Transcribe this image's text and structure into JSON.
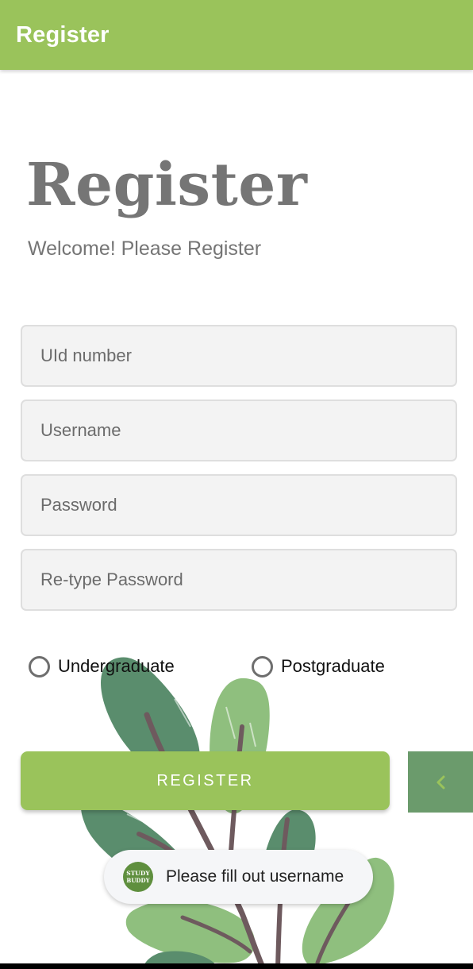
{
  "app_bar": {
    "title": "Register"
  },
  "main": {
    "heading": "Register",
    "subtitle": "Welcome! Please Register"
  },
  "form": {
    "uid": {
      "placeholder": "UId number",
      "value": ""
    },
    "username": {
      "placeholder": "Username",
      "value": ""
    },
    "password": {
      "placeholder": "Password",
      "value": ""
    },
    "retype_password": {
      "placeholder": "Re-type Password",
      "value": ""
    },
    "level_options": [
      {
        "label": "Undergraduate",
        "selected": false
      },
      {
        "label": "Postgraduate",
        "selected": false
      }
    ],
    "register_label": "REGISTER"
  },
  "back_tab": {
    "icon": "chevron-left-icon"
  },
  "toast": {
    "logo_text": [
      "STUDY",
      "BUDDY"
    ],
    "message": "Please fill out username"
  },
  "colors": {
    "accent": "#9ac35b",
    "back_tab": "#6b9b6c",
    "toast_logo": "#5f8f3e",
    "text_gray": "#757575"
  }
}
